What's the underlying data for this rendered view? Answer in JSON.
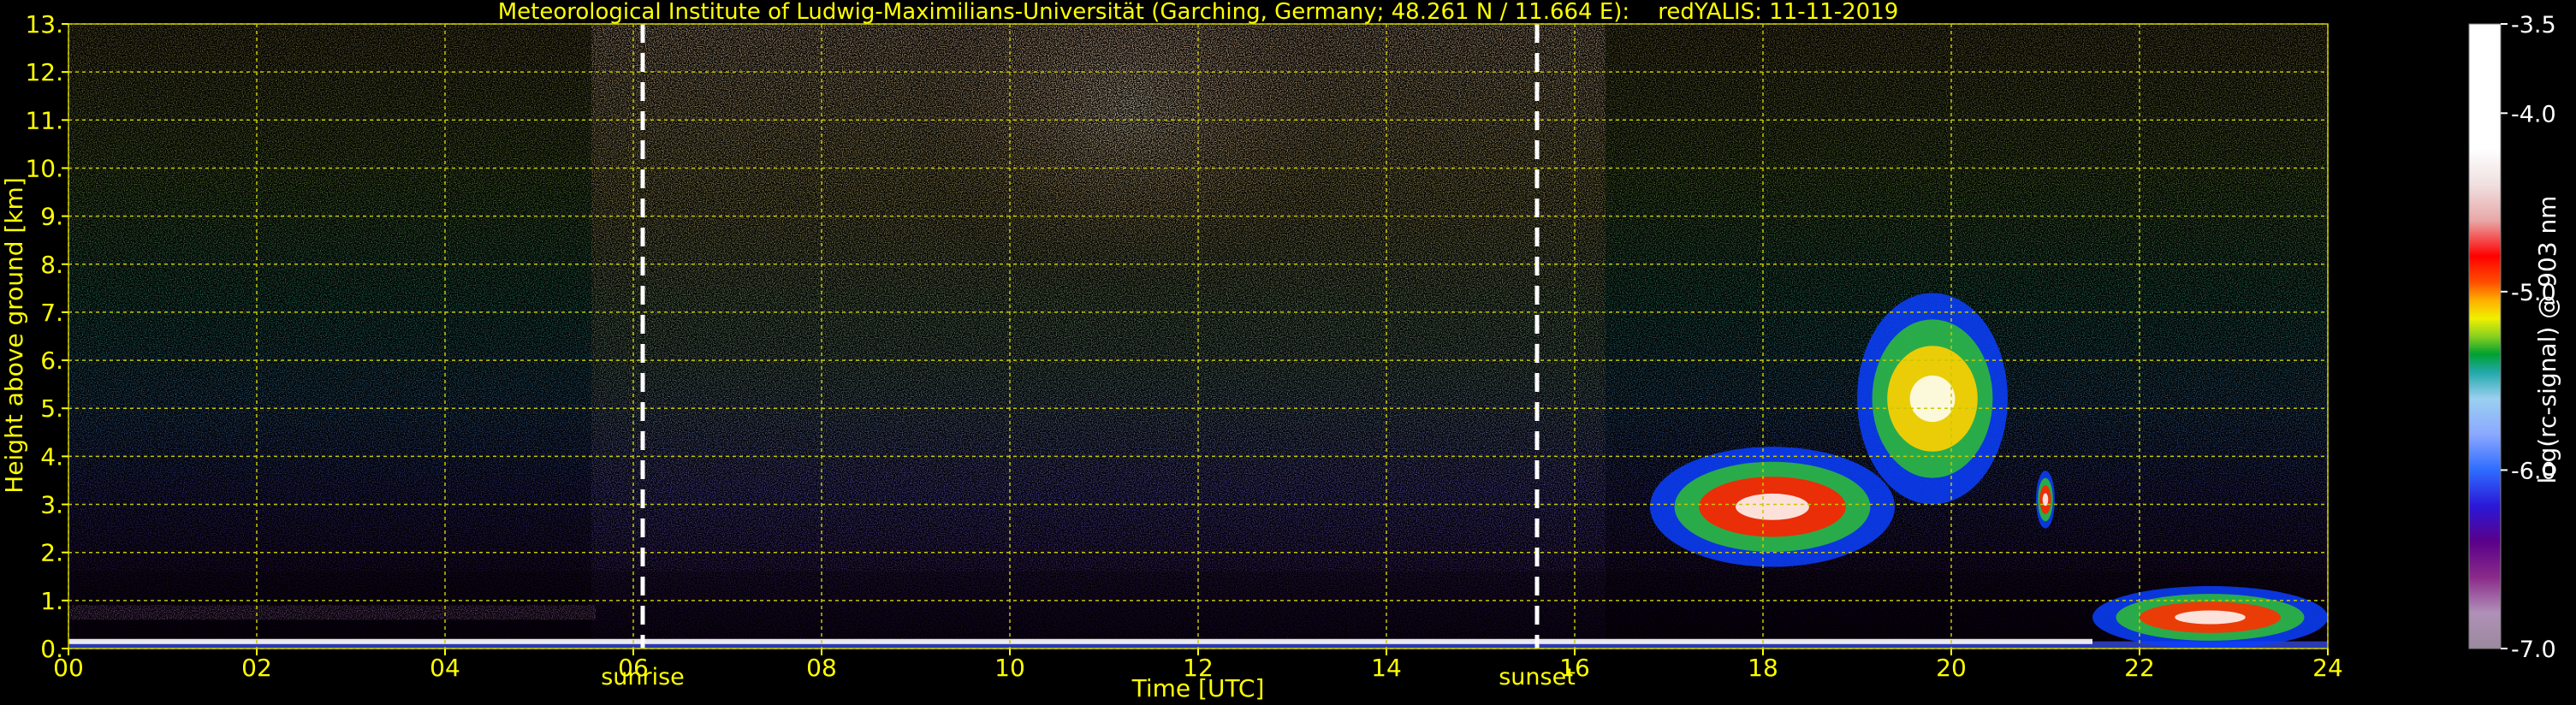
{
  "chart_data": {
    "type": "heatmap",
    "title": "Meteorological Institute of Ludwig-Maximilians-Universität (Garching, Germany; 48.261 N / 11.664 E):    redYALIS: 11-11-2019",
    "xlabel": "Time [UTC]",
    "ylabel": "Height above ground [km]",
    "xlim": [
      0,
      24
    ],
    "ylim": [
      0,
      13
    ],
    "x_ticks": [
      {
        "value": 0,
        "label": "00"
      },
      {
        "value": 2,
        "label": "02"
      },
      {
        "value": 4,
        "label": "04"
      },
      {
        "value": 6,
        "label": "06"
      },
      {
        "value": 8,
        "label": "08"
      },
      {
        "value": 10,
        "label": "10"
      },
      {
        "value": 12,
        "label": "12"
      },
      {
        "value": 14,
        "label": "14"
      },
      {
        "value": 16,
        "label": "16"
      },
      {
        "value": 18,
        "label": "18"
      },
      {
        "value": 20,
        "label": "20"
      },
      {
        "value": 22,
        "label": "22"
      },
      {
        "value": 24,
        "label": "24"
      }
    ],
    "y_ticks": [
      {
        "value": 0,
        "label": "0."
      },
      {
        "value": 1,
        "label": "1."
      },
      {
        "value": 2,
        "label": "2."
      },
      {
        "value": 3,
        "label": "3."
      },
      {
        "value": 4,
        "label": "4."
      },
      {
        "value": 5,
        "label": "5."
      },
      {
        "value": 6,
        "label": "6."
      },
      {
        "value": 7,
        "label": "7."
      },
      {
        "value": 8,
        "label": "8."
      },
      {
        "value": 9,
        "label": "9."
      },
      {
        "value": 10,
        "label": "10."
      },
      {
        "value": 11,
        "label": "11."
      },
      {
        "value": 12,
        "label": "12."
      },
      {
        "value": 13,
        "label": "13."
      }
    ],
    "grid": true,
    "markers": [
      {
        "label": "sunrise",
        "x": 6.1
      },
      {
        "label": "sunset",
        "x": 15.6
      }
    ],
    "colorbar": {
      "label": "log(rc-signal) @ 903 nm",
      "min": -7.0,
      "max": -3.5,
      "ticks": [
        {
          "value": -3.5,
          "label": "-3.5"
        },
        {
          "value": -4.0,
          "label": "-4.0"
        },
        {
          "value": -5.0,
          "label": "-5.0"
        },
        {
          "value": -6.0,
          "label": "-6.0"
        },
        {
          "value": -7.0,
          "label": "-7.0"
        }
      ],
      "stops": [
        {
          "value": -7.0,
          "color": "#9a8a9e"
        },
        {
          "value": -6.8,
          "color": "#b090b8"
        },
        {
          "value": -6.6,
          "color": "#8a2a8a"
        },
        {
          "value": -6.4,
          "color": "#5a008a"
        },
        {
          "value": -6.2,
          "color": "#2a18d8"
        },
        {
          "value": -6.0,
          "color": "#2e6cff"
        },
        {
          "value": -5.8,
          "color": "#8ca8ff"
        },
        {
          "value": -5.6,
          "color": "#9ad0f0"
        },
        {
          "value": -5.45,
          "color": "#20a8a8"
        },
        {
          "value": -5.35,
          "color": "#00a030"
        },
        {
          "value": -5.25,
          "color": "#8ad020"
        },
        {
          "value": -5.15,
          "color": "#f0f000"
        },
        {
          "value": -5.05,
          "color": "#ffb000"
        },
        {
          "value": -4.95,
          "color": "#ff5000"
        },
        {
          "value": -4.8,
          "color": "#ff0000"
        },
        {
          "value": -4.6,
          "color": "#e8a8a8"
        },
        {
          "value": -4.4,
          "color": "#f0e0e0"
        },
        {
          "value": -4.2,
          "color": "#ffffff"
        },
        {
          "value": -3.5,
          "color": "#ffffff"
        }
      ]
    },
    "features": [
      {
        "kind": "cloud-layer",
        "x": [
          16.8,
          19.4
        ],
        "y": [
          1.7,
          4.2
        ],
        "color": "#ff2000"
      },
      {
        "kind": "cloud-layer",
        "x": [
          19.0,
          20.6
        ],
        "y": [
          3.0,
          7.4
        ],
        "color": "#ffd000"
      },
      {
        "kind": "cloud-layer",
        "x": [
          20.9,
          21.1
        ],
        "y": [
          2.5,
          3.7
        ],
        "color": "#ff2000"
      },
      {
        "kind": "boundary-layer",
        "x": [
          21.5,
          24.0
        ],
        "y": [
          0.0,
          1.3
        ],
        "color": "#ff3000"
      }
    ],
    "colors": {
      "text": "#ffff00",
      "grid": "#c8c800",
      "background": "#000000",
      "markers": "#ffffff"
    }
  }
}
